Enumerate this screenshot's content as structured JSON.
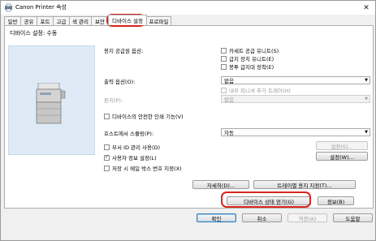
{
  "window": {
    "title": "Canon Printer 속성",
    "close_glyph": "✕"
  },
  "tabs": [
    {
      "label": "일반"
    },
    {
      "label": "공유"
    },
    {
      "label": "포트"
    },
    {
      "label": "고급"
    },
    {
      "label": "색 관리"
    },
    {
      "label": "보안"
    },
    {
      "label": "디바이스 설정"
    },
    {
      "label": "프로파일"
    }
  ],
  "active_tab": "디바이스 설정",
  "panel": {
    "mode_label": "디바이스 설정: 수동",
    "paper_source": {
      "label": "용지 공급원 옵션:",
      "options": [
        {
          "label": "카세트 공급 유니트(S)",
          "checked": false
        },
        {
          "label": "급지 장치 유니트(E)",
          "checked": false
        },
        {
          "label": "봉투 급지대 장착(E)",
          "checked": false
        }
      ]
    },
    "output": {
      "label": "출력 옵션(O):",
      "value": "없음",
      "inner_finisher_label": "내부 피니셔 추가 트레이(H)",
      "stapler_label": "펀치(P):",
      "stapler_value": "없음"
    },
    "secure_print_label": "디바이스의 안전한 인쇄 기능(V)",
    "spooling": {
      "label": "호스트에서 스풀링(P):",
      "value": "자동"
    },
    "dept_id": {
      "label": "부서 ID 관리 사용(D)",
      "checked": false,
      "button": "설정(S)..."
    },
    "user_info": {
      "label": "사용자 정보 설정(L)",
      "checked": true,
      "button": "설정(W)..."
    },
    "mailbox": {
      "label": "저장 시 메일 박스 번호 지정(X)",
      "checked": false
    },
    "buttons": {
      "details": "자세히(D)...",
      "tray_paper": "트레이별 용지 지정(T)...",
      "get_device_status": "디바이스 상태 얻기(G)",
      "info": "정보(B)"
    }
  },
  "footer": {
    "ok": "확인",
    "cancel": "취소",
    "apply": "적용(A)",
    "help": "도움말"
  },
  "highlight_color": "#d9251c"
}
